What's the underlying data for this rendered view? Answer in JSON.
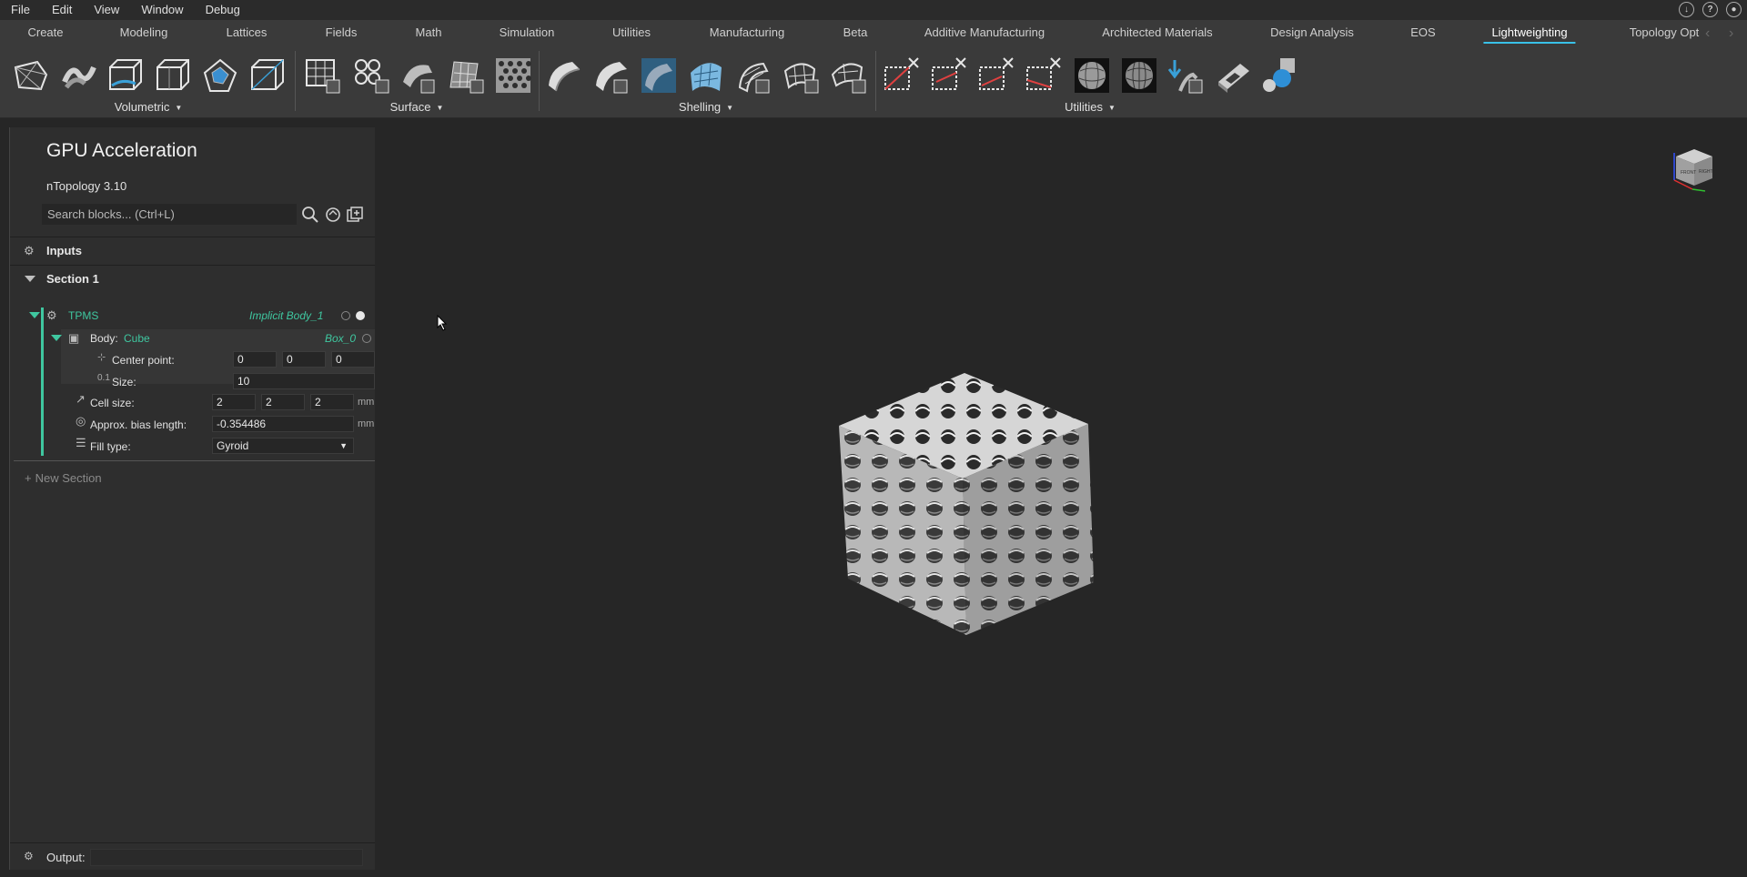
{
  "menubar": {
    "items": [
      "File",
      "Edit",
      "View",
      "Window",
      "Debug"
    ],
    "right_icons": [
      "download-icon",
      "help-icon",
      "user-icon"
    ]
  },
  "tabs": [
    "Create",
    "Modeling",
    "Lattices",
    "Fields",
    "Math",
    "Simulation",
    "Utilities",
    "Manufacturing",
    "Beta",
    "Additive Manufacturing",
    "Architected Materials",
    "Design Analysis",
    "EOS",
    "Lightweighting",
    "Topology Opt"
  ],
  "active_tab": "Lightweighting",
  "toolbar": {
    "groups": [
      {
        "label": "Volumetric",
        "tool_count": 6
      },
      {
        "label": "Surface",
        "tool_count": 5
      },
      {
        "label": "Shelling",
        "tool_count": 7
      },
      {
        "label": "Utilities",
        "tool_count": 9
      }
    ]
  },
  "panel": {
    "title": "GPU Acceleration",
    "version": "nTopology 3.10",
    "search_placeholder": "Search blocks... (Ctrl+L)",
    "inputs_label": "Inputs",
    "section_label": "Section 1",
    "block": {
      "name": "TPMS",
      "ref": "Implicit Body_1",
      "body": {
        "label": "Body:",
        "value": "Cube",
        "ref": "Box_0",
        "center_label": "Center point:",
        "center": [
          "0",
          "0",
          "0"
        ],
        "size_label": "Size:",
        "size": "10",
        "unit": "mm"
      },
      "cell_size_label": "Cell size:",
      "cell_size": [
        "2",
        "2",
        "2"
      ],
      "bias_label": "Approx. bias length:",
      "bias": "-0.354486",
      "fill_label": "Fill type:",
      "fill_value": "Gyroid",
      "unit": "mm"
    },
    "new_section": "New Section",
    "output_label": "Output:"
  },
  "colors": {
    "accent": "#39c1e8",
    "block_green": "#3fc7a0",
    "background": "#262626",
    "panel": "#2e2e2e",
    "ribbon": "#3a3a3a"
  }
}
